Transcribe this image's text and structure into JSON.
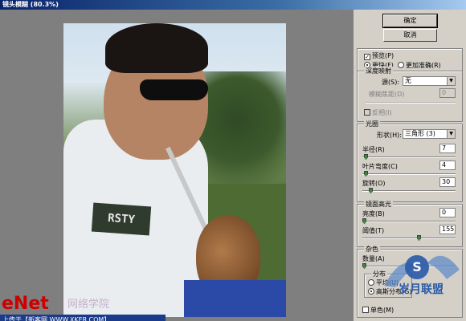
{
  "window": {
    "title": "镜头模糊 (80.3%)"
  },
  "buttons": {
    "ok": "确定",
    "cancel": "取消"
  },
  "preview": {
    "checkbox_label": "预览(P)",
    "checked": true,
    "mode_faster": "更快(F)",
    "mode_accurate": "更加准确(R)",
    "selected_mode": "faster"
  },
  "depth_map": {
    "legend": "深度映射",
    "source_label": "源(S):",
    "source_value": "无",
    "blur_focal_label": "模糊焦距(D)",
    "blur_focal_value": "0",
    "invert_label": "反相(I)"
  },
  "iris": {
    "legend": "光圈",
    "shape_label": "形状(H):",
    "shape_value": "三角形 (3)",
    "radius_label": "半径(R)",
    "radius_value": "7",
    "curvature_label": "叶片弯度(C)",
    "curvature_value": "4",
    "rotation_label": "旋转(O)",
    "rotation_value": "30"
  },
  "specular": {
    "legend": "镜面高光",
    "brightness_label": "亮度(B)",
    "brightness_value": "0",
    "threshold_label": "阈值(T)",
    "threshold_value": "155"
  },
  "noise": {
    "legend": "杂色",
    "amount_label": "数量(A)",
    "distribution_legend": "分布",
    "uniform_label": "平均(U)",
    "gaussian_label": "高斯分布(G)",
    "selected_distribution": "gaussian",
    "mono_label": "单色(M)"
  },
  "photo": {
    "shirt_text": "RSTY"
  },
  "watermarks": {
    "left_brand": "eNet",
    "left_cn": "网络学院",
    "upload_bar": "上传于【新客网 WWW.XKER.COM】",
    "right_brand": "S",
    "right_cn": "岁月联盟"
  },
  "colors": {
    "title_bar": "#0a246a",
    "dialog_bg": "#d4d0c8",
    "slider_thumb": "#3a8a3a"
  }
}
